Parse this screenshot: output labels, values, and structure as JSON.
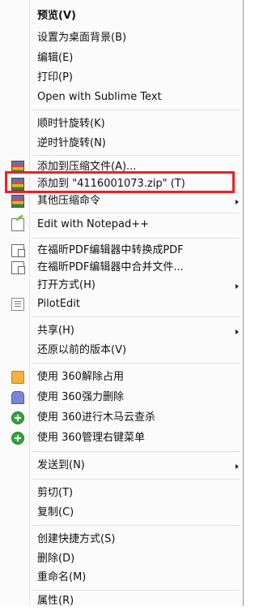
{
  "menu": {
    "items": [
      {
        "label": "预览(V)",
        "bold": true
      },
      {
        "label": "设置为桌面背景(B)"
      },
      {
        "label": "编辑(E)"
      },
      {
        "label": "打印(P)"
      },
      {
        "label": "Open with Sublime Text"
      },
      {
        "label": "顺时针旋转(K)"
      },
      {
        "label": "逆时针旋转(N)"
      },
      {
        "label": "添加到压缩文件(A)...",
        "icon": "archive-icon"
      },
      {
        "label": "添加到 \"4116001073.zip\" (T)",
        "icon": "archive-icon"
      },
      {
        "label": "其他压缩命令",
        "icon": "archive-icon",
        "submenu": true
      },
      {
        "label": "Edit with Notepad++",
        "icon": "notepad-icon"
      },
      {
        "label": "在福昕PDF编辑器中转换成PDF",
        "icon": "pdf-convert-icon"
      },
      {
        "label": "在福昕PDF编辑器中合并文件...",
        "icon": "pdf-merge-icon"
      },
      {
        "label": "打开方式(H)",
        "submenu": true
      },
      {
        "label": "PilotEdit",
        "icon": "pilotedit-icon"
      },
      {
        "label": "共享(H)",
        "submenu": true
      },
      {
        "label": "还原以前的版本(V)"
      },
      {
        "label": "使用 360解除占用",
        "icon": "unlock-folder-icon"
      },
      {
        "label": "使用 360强力删除",
        "icon": "shredder-icon"
      },
      {
        "label": "使用 360进行木马云查杀",
        "icon": "360-scan-icon"
      },
      {
        "label": "使用 360管理右键菜单",
        "icon": "360-menu-icon"
      },
      {
        "label": "发送到(N)",
        "submenu": true
      },
      {
        "label": "剪切(T)"
      },
      {
        "label": "复制(C)"
      },
      {
        "label": "创建快捷方式(S)"
      },
      {
        "label": "删除(D)"
      },
      {
        "label": "重命名(M)"
      },
      {
        "label": "属性(R)"
      }
    ]
  }
}
